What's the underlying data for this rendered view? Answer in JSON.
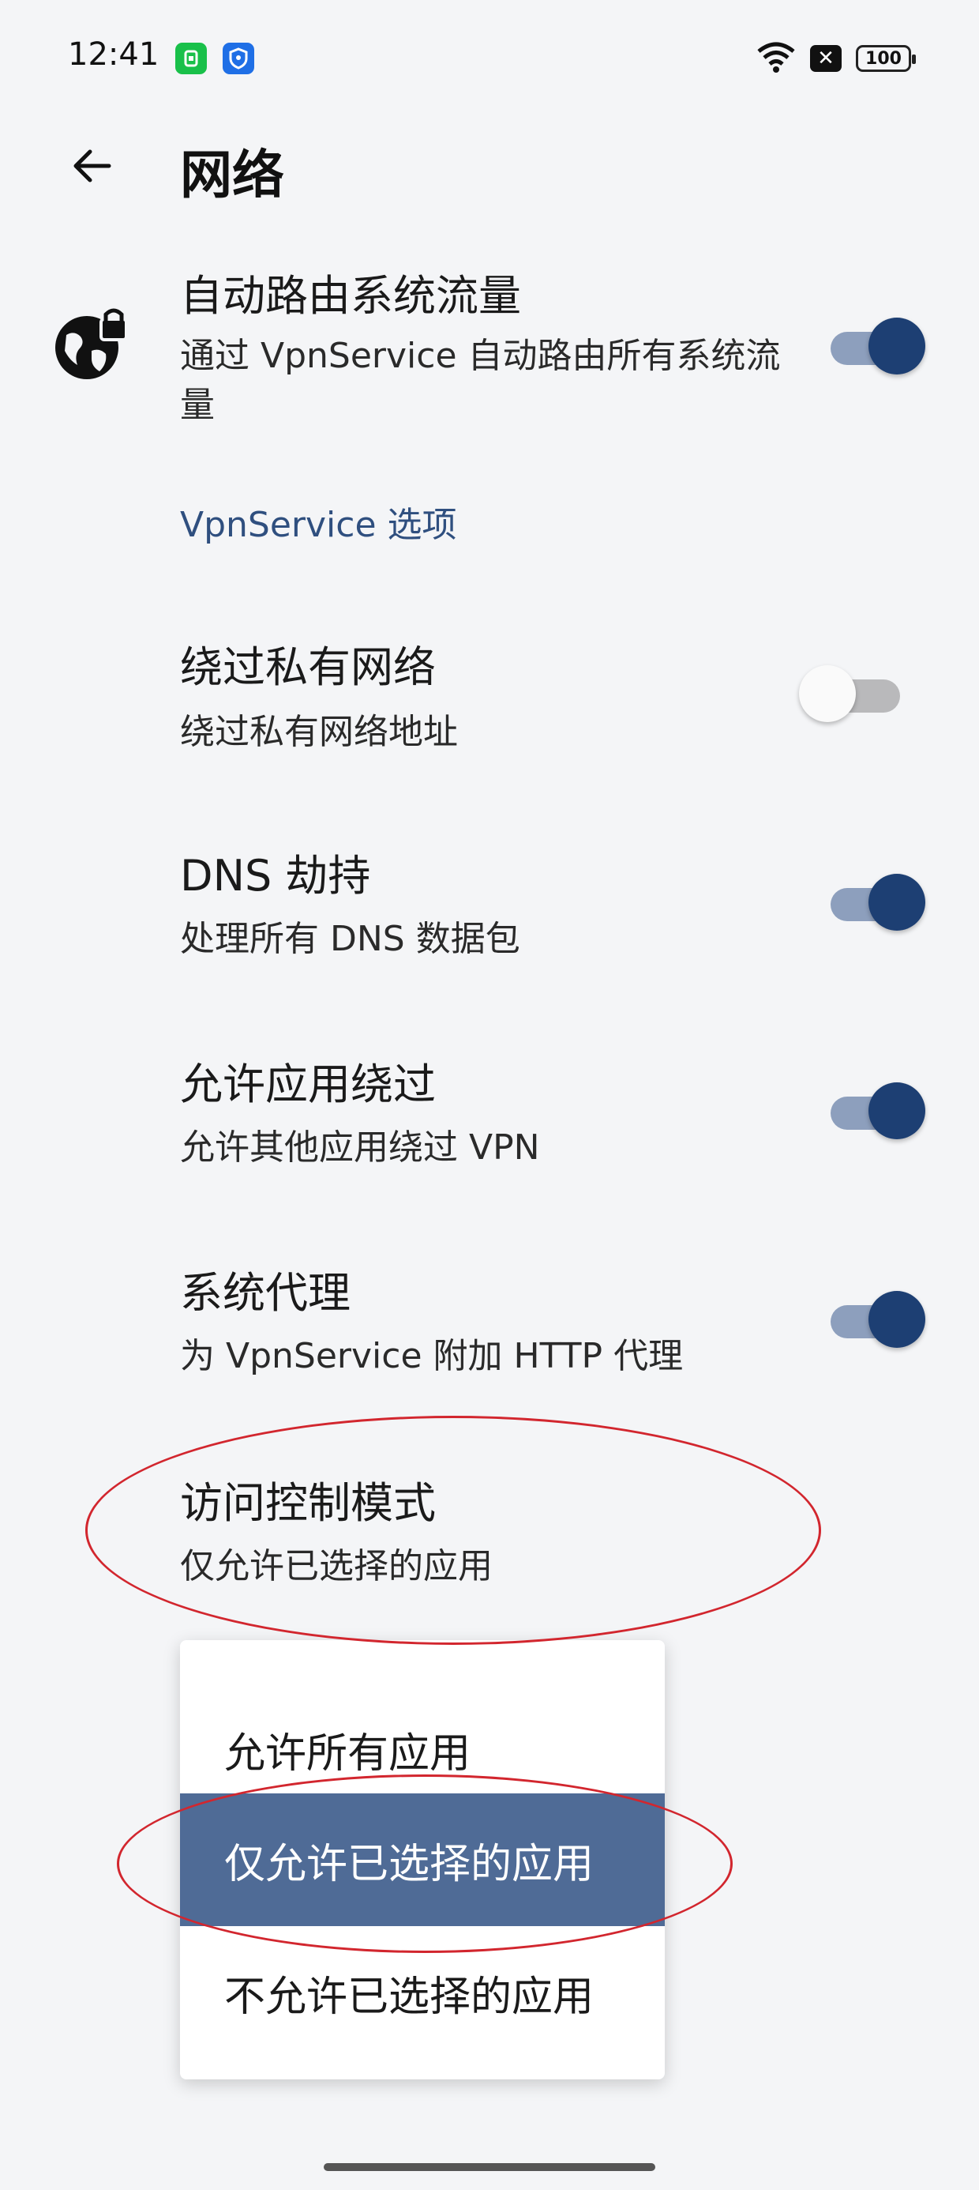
{
  "status_bar": {
    "time": "12:41",
    "battery": "100"
  },
  "app_bar": {
    "title": "网络"
  },
  "settings": {
    "auto_route": {
      "title": "自动路由系统流量",
      "subtitle": "通过 VpnService 自动路由所有系统流量",
      "enabled": true
    },
    "section_header": "VpnService 选项",
    "bypass_private": {
      "title": "绕过私有网络",
      "subtitle": "绕过私有网络地址",
      "enabled": false
    },
    "dns_hijack": {
      "title": "DNS 劫持",
      "subtitle": "处理所有 DNS 数据包",
      "enabled": true
    },
    "allow_bypass": {
      "title": "允许应用绕过",
      "subtitle": "允许其他应用绕过 VPN",
      "enabled": true
    },
    "system_proxy": {
      "title": "系统代理",
      "subtitle": "为 VpnService 附加 HTTP 代理",
      "enabled": true
    },
    "access_control": {
      "title": "访问控制模式",
      "subtitle": "仅允许已选择的应用"
    }
  },
  "access_menu": {
    "options": [
      "允许所有应用",
      "仅允许已选择的应用",
      "不允许已选择的应用"
    ],
    "selected_index": 1
  },
  "colors": {
    "accent": "#1d3f73",
    "selected_item": "#4f6b96",
    "annotation": "#d2262e"
  },
  "icons": [
    "back-arrow-icon",
    "vpn-lock-icon",
    "wifi-icon",
    "battery-icon"
  ]
}
